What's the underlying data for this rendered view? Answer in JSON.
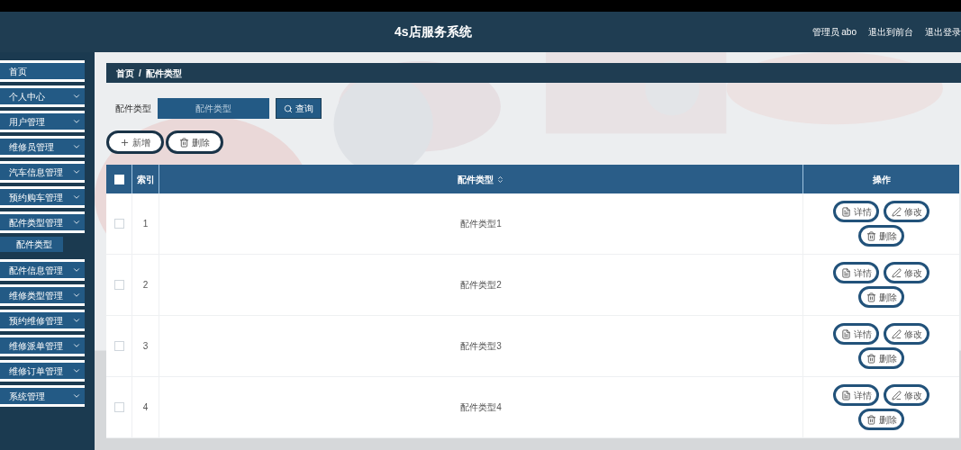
{
  "header": {
    "title": "4s店服务系统",
    "links": [
      "管理员 abo",
      "退出到前台",
      "退出登录"
    ]
  },
  "sidebar": {
    "items": [
      {
        "label": "首页",
        "kind": "link"
      },
      {
        "label": "个人中心",
        "kind": "menu"
      },
      {
        "label": "用户管理",
        "kind": "menu"
      },
      {
        "label": "维修员管理",
        "kind": "menu"
      },
      {
        "label": "汽车信息管理",
        "kind": "menu"
      },
      {
        "label": "预约购车管理",
        "kind": "menu"
      },
      {
        "label": "配件类型管理",
        "kind": "menu",
        "children": [
          {
            "label": "配件类型"
          }
        ]
      },
      {
        "label": "配件信息管理",
        "kind": "menu"
      },
      {
        "label": "维修类型管理",
        "kind": "menu"
      },
      {
        "label": "预约维修管理",
        "kind": "menu"
      },
      {
        "label": "维修派单管理",
        "kind": "menu"
      },
      {
        "label": "维修订单管理",
        "kind": "menu"
      },
      {
        "label": "系统管理",
        "kind": "menu"
      }
    ]
  },
  "breadcrumb": {
    "items": [
      "首页",
      "配件类型"
    ],
    "separator": "/"
  },
  "search": {
    "label": "配件类型",
    "placeholder": "配件类型",
    "button": "查询"
  },
  "toolbar": [
    {
      "label": "新增",
      "kind": "add"
    },
    {
      "label": "删除",
      "kind": "delete"
    }
  ],
  "table": {
    "header_checked": false,
    "columns": [
      "索引",
      "配件类型",
      "操作"
    ],
    "rows": [
      {
        "checked": false,
        "index": "1",
        "type": "配件类型1",
        "actions": [
          {
            "label": "详情",
            "kind": "detail"
          },
          {
            "label": "修改",
            "kind": "edit"
          },
          {
            "label": "删除",
            "kind": "delete"
          }
        ]
      },
      {
        "checked": false,
        "index": "2",
        "type": "配件类型2",
        "actions": [
          {
            "label": "详情",
            "kind": "detail"
          },
          {
            "label": "修改",
            "kind": "edit"
          },
          {
            "label": "删除",
            "kind": "delete"
          }
        ]
      },
      {
        "checked": false,
        "index": "3",
        "type": "配件类型3",
        "actions": [
          {
            "label": "详情",
            "kind": "detail"
          },
          {
            "label": "修改",
            "kind": "edit"
          },
          {
            "label": "删除",
            "kind": "delete"
          }
        ]
      },
      {
        "checked": false,
        "index": "4",
        "type": "配件类型4",
        "actions": [
          {
            "label": "详情",
            "kind": "detail"
          },
          {
            "label": "修改",
            "kind": "edit"
          },
          {
            "label": "删除",
            "kind": "delete"
          }
        ]
      }
    ]
  }
}
